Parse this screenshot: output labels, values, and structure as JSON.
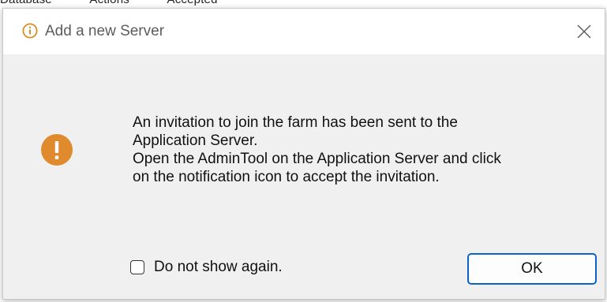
{
  "background_window": {
    "partial_labels": [
      "Database",
      "Actions",
      "Accepted"
    ]
  },
  "dialog": {
    "title": "Add a new Server",
    "title_icon": "info-icon",
    "close_icon": "close-icon",
    "status_icon": "warning-icon",
    "message_lines": [
      "An invitation to join the farm has been sent to the",
      "Application Server.",
      "Open the AdminTool on the Application Server and click",
      "on the notification icon to accept the invitation."
    ],
    "checkbox": {
      "label": "Do not show again.",
      "checked": false
    },
    "ok_label": "OK"
  },
  "colors": {
    "title_icon": "#d98c21",
    "warning_icon": "#e08a2e",
    "ok_border": "#0a64c8"
  }
}
